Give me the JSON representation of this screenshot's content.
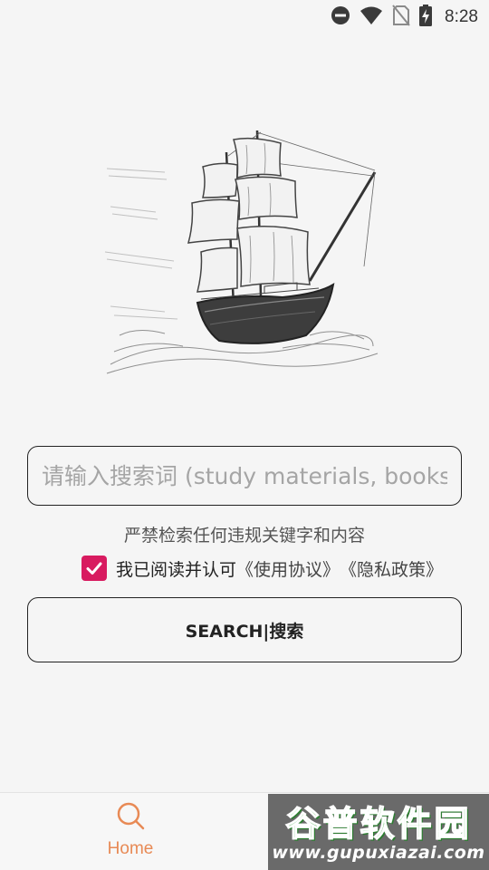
{
  "status_bar": {
    "time": "8:28",
    "icons": [
      "do-not-disturb-icon",
      "wifi-icon",
      "no-sim-icon",
      "battery-charging-icon"
    ]
  },
  "hero": {
    "image": "sailing-ship-sketch"
  },
  "search": {
    "placeholder": "请输入搜索词 (study materials, books",
    "value": ""
  },
  "notice": "严禁检索任何违规关键字和内容",
  "agreement": {
    "checked": true,
    "text": "我已阅读并认可",
    "user_agreement": "《使用协议》",
    "privacy_policy": "《隐私政策》"
  },
  "search_button": {
    "label": "SEARCH|搜索"
  },
  "bottom_nav": {
    "items": [
      {
        "label": "Home",
        "icon": "search-icon",
        "active": true
      }
    ]
  },
  "watermark": {
    "title": "谷普软件园",
    "url": "www.gupuxiazai.com"
  },
  "colors": {
    "background": "#f5f5f5",
    "checkbox": "#d81b60",
    "nav_active": "#e88a55",
    "watermark_bg": "#6a6a6a",
    "watermark_title": "#4caf50"
  }
}
